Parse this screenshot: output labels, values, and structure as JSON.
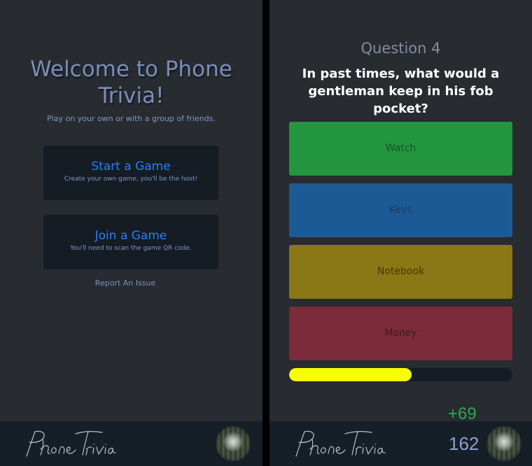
{
  "home": {
    "title": "Welcome to Phone Trivia!",
    "subtitle": "Play on your own or with a group of friends.",
    "start_game": {
      "label": "Start a Game",
      "description": "Create your own game, you'll be the host!"
    },
    "join_game": {
      "label": "Join a Game",
      "description": "You'll need to scan the game QR code."
    },
    "report_link": "Report An Issue"
  },
  "question_screen": {
    "question_number": "Question 4",
    "question_text": "In past times, what would a gentleman keep in his fob pocket?",
    "answers": [
      {
        "label": "Watch",
        "color": "#23963f"
      },
      {
        "label": "Keys",
        "color": "#1c5a96"
      },
      {
        "label": "Notebook",
        "color": "#8a7715"
      },
      {
        "label": "Money",
        "color": "#7b2b39"
      }
    ],
    "timer_progress_fraction": 0.55,
    "timer_color": "#f6ff00",
    "score_delta": "+69",
    "score_total": "162"
  },
  "footer": {
    "logo_text": "Phone Trivia",
    "avatar_icon": "forest-avatar"
  }
}
